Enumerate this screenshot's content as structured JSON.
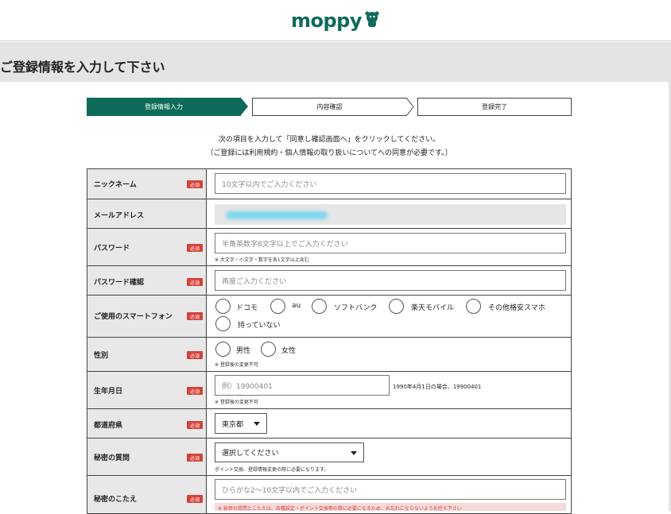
{
  "header": {
    "logo_text": "moppy",
    "logo_mascot": "moppy-mascot-icon"
  },
  "page_title": "ご登録情報を入力して下さい",
  "steps": [
    {
      "label": "登録情報入力",
      "active": true
    },
    {
      "label": "内容確認",
      "active": false
    },
    {
      "label": "登録完了",
      "active": false
    }
  ],
  "intro": {
    "line1": "次の項目を入力して「同意し確認画面へ」をクリックしてください。",
    "line2": "（ご登録には利用規約・個人情報の取り扱いについてへの同意が必要です。）"
  },
  "required_badge": "必須",
  "form": {
    "nickname": {
      "label": "ニックネーム",
      "placeholder": "10文字以内でご入力ください"
    },
    "email": {
      "label": "メールアドレス"
    },
    "password": {
      "label": "パスワード",
      "placeholder": "半角英数字8文字以上でご入力ください",
      "note": "※ 大文字・小文字・数字を各1文字以上含む"
    },
    "password_confirm": {
      "label": "パスワード確認",
      "placeholder": "再度ご入力ください"
    },
    "smartphone": {
      "label": "ご使用のスマートフォン",
      "options": [
        "ドコモ",
        "au",
        "ソフトバンク",
        "楽天モバイル",
        "その他格安スマホ",
        "持っていない"
      ]
    },
    "gender": {
      "label": "性別",
      "options": [
        "男性",
        "女性"
      ],
      "note": "※ 登録後の変更不可"
    },
    "birthday": {
      "label": "生年月日",
      "placeholder": "例）19900401",
      "hint": "1990年4月1日の場合、19900401",
      "note": "※ 登録後の変更不可"
    },
    "prefecture": {
      "label": "都道府県",
      "value": "東京都"
    },
    "secret_question": {
      "label": "秘密の質問",
      "value": "選択してください",
      "note": "ポイント交換、登録情報変更の際に必要になります。"
    },
    "secret_answer": {
      "label": "秘密のこたえ",
      "placeholder": "ひらがな2〜10文字以内でご入力ください",
      "note": "※ 秘密の質問とこたえは、各種設定・ポイント交換等の際に必要になるため、お忘れにならないようお控え下さい"
    }
  },
  "colors": {
    "brand": "#0e6b5a",
    "required": "#d6413a"
  }
}
